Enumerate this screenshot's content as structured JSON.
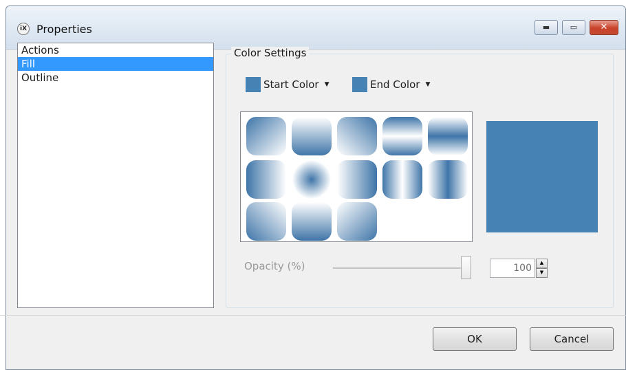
{
  "window": {
    "title": "Properties",
    "icon": "ix-logo-icon"
  },
  "caption_buttons": {
    "minimize": "minimize-icon",
    "maximize": "maximize-icon",
    "close": "close-icon"
  },
  "sidebar": {
    "items": [
      {
        "label": "Actions",
        "selected": false
      },
      {
        "label": "Fill",
        "selected": true
      },
      {
        "label": "Outline",
        "selected": false
      }
    ]
  },
  "color_settings": {
    "title": "Color Settings",
    "start_color": {
      "label": "Start Color",
      "color": "#4682b4"
    },
    "end_color": {
      "label": "End Color",
      "color": "#4682b4"
    },
    "preview_color": "#4682b4",
    "gradient_presets": 13
  },
  "opacity": {
    "label": "Opacity (%)",
    "value": "100"
  },
  "footer": {
    "ok_label": "OK",
    "cancel_label": "Cancel"
  },
  "colors": {
    "selection": "#3399ff",
    "accent": "#4682b4"
  }
}
